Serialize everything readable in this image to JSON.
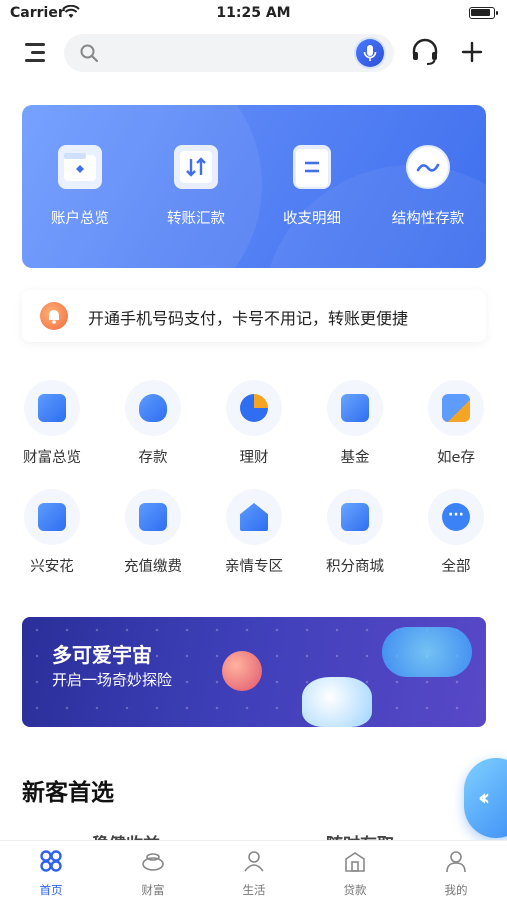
{
  "status_bar": {
    "carrier": "Carrier",
    "time": "11:25 AM"
  },
  "top_bar": {
    "search": {
      "placeholder": ""
    }
  },
  "quick_actions": [
    {
      "label": "账户总览",
      "icon": "wallet-icon"
    },
    {
      "label": "转账汇款",
      "icon": "transfer-icon"
    },
    {
      "label": "收支明细",
      "icon": "document-icon"
    },
    {
      "label": "结构性存款",
      "icon": "wave-icon"
    }
  ],
  "notice": {
    "text": "开通手机号码支付，卡号不用记，转账更便捷"
  },
  "services_row1": [
    {
      "label": "财富总览",
      "icon": "wealth-icon",
      "color": "#3b82f6"
    },
    {
      "label": "存款",
      "icon": "piggy-bank-icon",
      "color": "#2f6ef0"
    },
    {
      "label": "理财",
      "icon": "pie-chart-icon",
      "color": "#f5a524"
    },
    {
      "label": "基金",
      "icon": "fund-chart-icon",
      "color": "#3b82f6"
    },
    {
      "label": "如e存",
      "icon": "puzzle-icon",
      "color": "#f59e0b"
    }
  ],
  "services_row2": [
    {
      "label": "兴安花",
      "icon": "card-icon",
      "color": "#3b82f6"
    },
    {
      "label": "充值缴费",
      "icon": "yuan-download-icon",
      "color": "#2f6ef0"
    },
    {
      "label": "亲情专区",
      "icon": "family-home-icon",
      "color": "#2f6ef0"
    },
    {
      "label": "积分商城",
      "icon": "shopping-bag-icon",
      "color": "#3b82f6"
    },
    {
      "label": "全部",
      "icon": "more-icon",
      "color": "#3b82f6"
    }
  ],
  "promo": {
    "title": "多可爱宇宙",
    "subtitle": "开启一场奇妙探险"
  },
  "section": {
    "title": "新客首选"
  },
  "peek": {
    "left": "稳健收益",
    "right": "随时存取"
  },
  "tabs": [
    {
      "label": "首页",
      "icon": "home-icon",
      "active": true
    },
    {
      "label": "财富",
      "icon": "wealth-tab-icon",
      "active": false
    },
    {
      "label": "生活",
      "icon": "life-icon",
      "active": false
    },
    {
      "label": "贷款",
      "icon": "loan-icon",
      "active": false
    },
    {
      "label": "我的",
      "icon": "profile-icon",
      "active": false
    }
  ],
  "colors": {
    "accent": "#2f62e9",
    "banner": "#5a86f6"
  }
}
